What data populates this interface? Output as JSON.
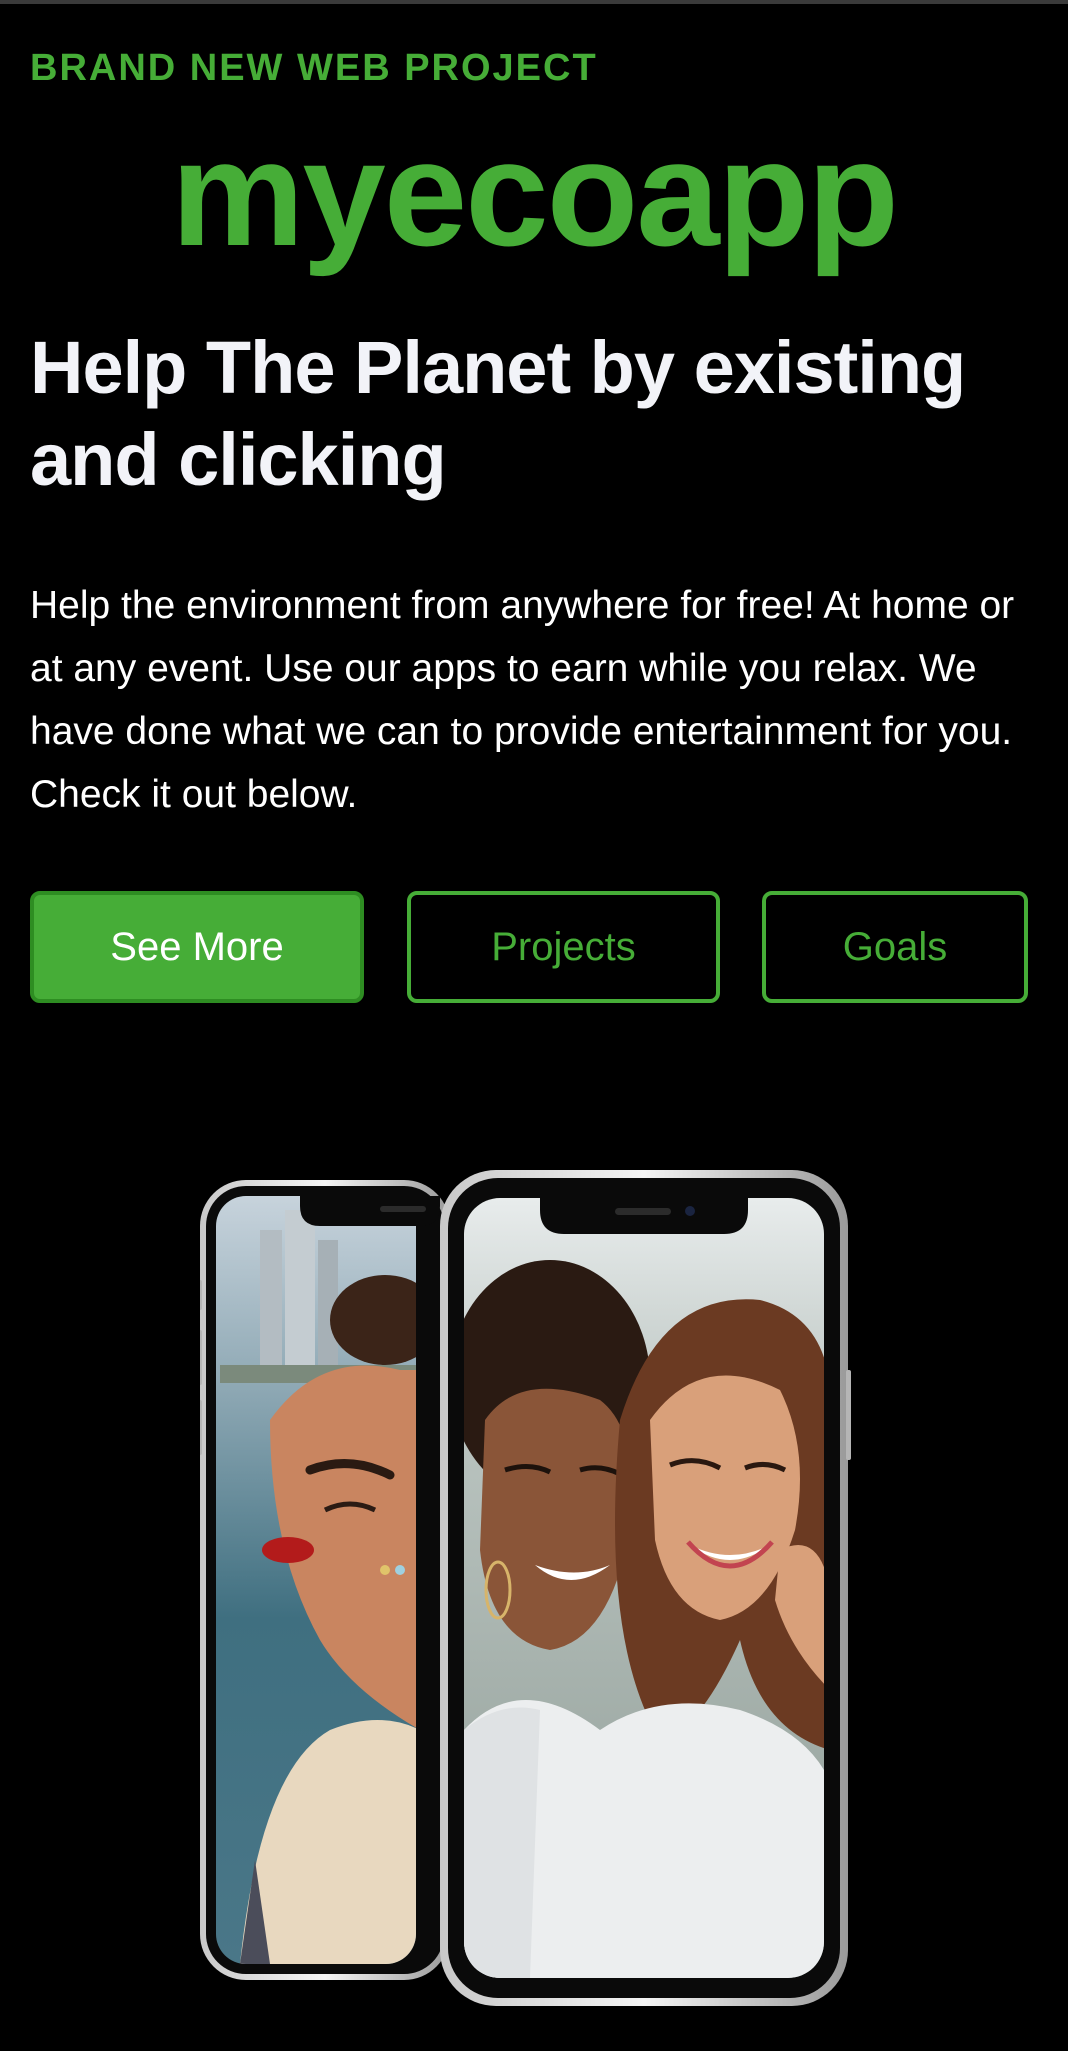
{
  "hero": {
    "eyebrow": "BRAND NEW WEB PROJECT",
    "brand": "myecoapp",
    "headline": "Help The Planet by existing and clicking",
    "description": "Help the environment from anywhere for free! At home or at any event. Use our apps to earn while you relax. We have done what we can to provide entertainment for you. Check it out below."
  },
  "buttons": {
    "see_more": "See More",
    "projects": "Projects",
    "goals": "Goals"
  },
  "colors": {
    "accent": "#46ad37",
    "primary_button_bg": "#46ad37",
    "background": "#000000"
  },
  "showcase": {
    "device": "smartphone",
    "images": [
      "portrait-woman-with-face-gems",
      "two-smiling-friends-selfie"
    ]
  }
}
